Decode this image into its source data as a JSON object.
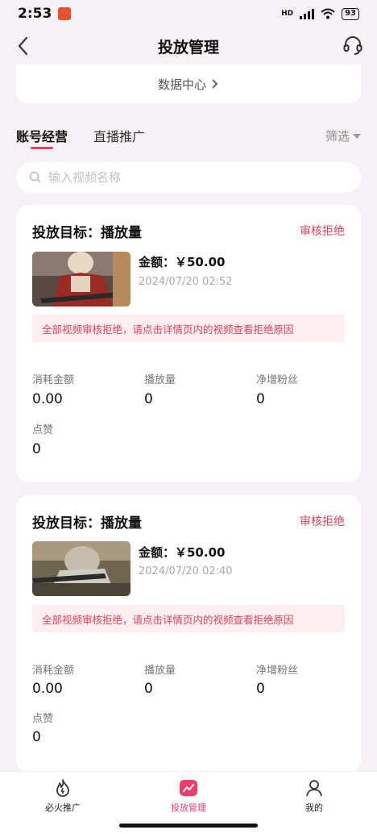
{
  "status": {
    "time": "2:53",
    "battery": "93"
  },
  "nav": {
    "title": "投放管理"
  },
  "data_center": {
    "label": "数据中心"
  },
  "tabs": [
    {
      "label": "账号经营",
      "active": true
    },
    {
      "label": "直播推广",
      "active": false
    }
  ],
  "filter": {
    "label": "筛选"
  },
  "search": {
    "placeholder": "输入视频名称",
    "value": ""
  },
  "cards": [
    {
      "title": "投放目标：播放量",
      "status": "审核拒绝",
      "amount": "金额：￥50.00",
      "date": "2024/07/20 02:52",
      "reject_message": "全部视频审核拒绝，请点击详情页内的视频查看拒绝原因",
      "stats": [
        {
          "label": "消耗金额",
          "value": "0.00"
        },
        {
          "label": "播放量",
          "value": "0"
        },
        {
          "label": "净增粉丝",
          "value": "0"
        },
        {
          "label": "点赞",
          "value": "0"
        }
      ]
    },
    {
      "title": "投放目标：播放量",
      "status": "审核拒绝",
      "amount": "金额：￥50.00",
      "date": "2024/07/20 02:40",
      "reject_message": "全部视频审核拒绝，请点击详情页内的视频查看拒绝原因",
      "stats": [
        {
          "label": "消耗金额",
          "value": "0.00"
        },
        {
          "label": "播放量",
          "value": "0"
        },
        {
          "label": "净增粉丝",
          "value": "0"
        },
        {
          "label": "点赞",
          "value": "0"
        }
      ]
    }
  ],
  "bottom_nav": [
    {
      "label": "必火推广",
      "icon": "flame-icon",
      "active": false
    },
    {
      "label": "投放管理",
      "icon": "chart-icon",
      "active": true
    },
    {
      "label": "我的",
      "icon": "person-icon",
      "active": false
    }
  ],
  "colors": {
    "accent": "#ec3f6a",
    "reject": "#e0435c",
    "background": "#f6f1f4"
  }
}
